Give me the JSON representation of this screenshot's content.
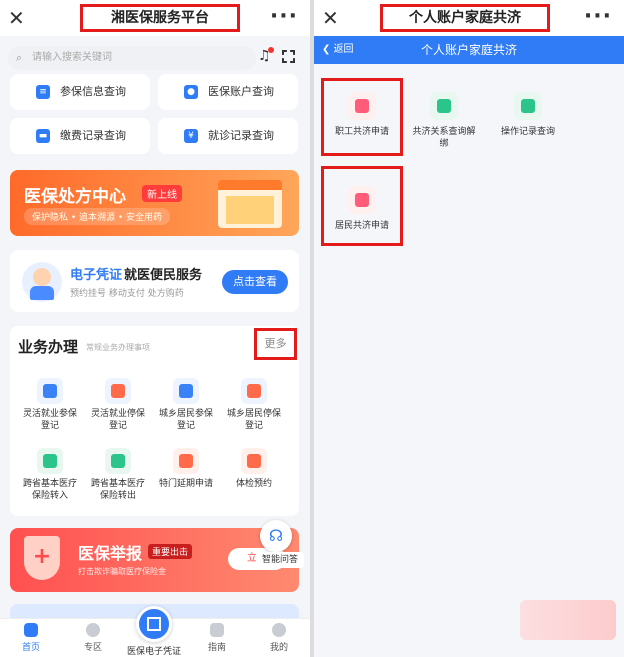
{
  "left": {
    "title": "湘医保服务平台",
    "search_placeholder": "请输入搜索关键词",
    "quick": [
      {
        "label": "参保信息查询"
      },
      {
        "label": "医保账户查询"
      },
      {
        "label": "缴费记录查询"
      },
      {
        "label": "就诊记录查询"
      }
    ],
    "banner1": {
      "title": "医保处方中心",
      "badge": "新上线",
      "subtitle": "保护隐私 • 追本溯源 • 安全用药"
    },
    "ecard": {
      "title_a": "电子凭证",
      "title_b": "就医便民服务",
      "subtitle": "预约挂号   移动支付   处方购药",
      "button": "点击查看"
    },
    "biz": {
      "title": "业务办理",
      "subtitle": "常规业务办理事项",
      "more": "更多",
      "items": [
        {
          "label": "灵活就业参保\n登记"
        },
        {
          "label": "灵活就业停保\n登记"
        },
        {
          "label": "城乡居民参保\n登记"
        },
        {
          "label": "城乡居民停保\n登记"
        },
        {
          "label": "跨省基本医疗\n保险转入"
        },
        {
          "label": "跨省基本医疗\n保险转出"
        },
        {
          "label": "特门延期申请"
        },
        {
          "label": "体检预约"
        }
      ]
    },
    "banner2": {
      "title": "医保举报",
      "badge": "重要出击",
      "subtitle": "打击欺诈骗取医疗保险金",
      "cta": "立即"
    },
    "assist_label": "智能问答",
    "tabs": [
      {
        "label": "首页"
      },
      {
        "label": "专区"
      },
      {
        "label": "医保电子凭证"
      },
      {
        "label": "指南"
      },
      {
        "label": "我的"
      }
    ]
  },
  "right": {
    "title": "个人账户家庭共济",
    "back": "返回",
    "nav_title": "个人账户家庭共济",
    "functions": [
      {
        "label": "职工共济申请"
      },
      {
        "label": "共济关系查询解\n绑"
      },
      {
        "label": "操作记录查询"
      },
      {
        "label": "居民共济申请"
      }
    ]
  },
  "colors": {
    "accent": "#2f7cf6",
    "highlight": "#e31b1b",
    "orange": "#ff7a2a"
  },
  "icons": [
    "close-icon",
    "more-dots-icon",
    "search-icon",
    "bell-icon",
    "scan-icon",
    "chevron-left-icon"
  ]
}
